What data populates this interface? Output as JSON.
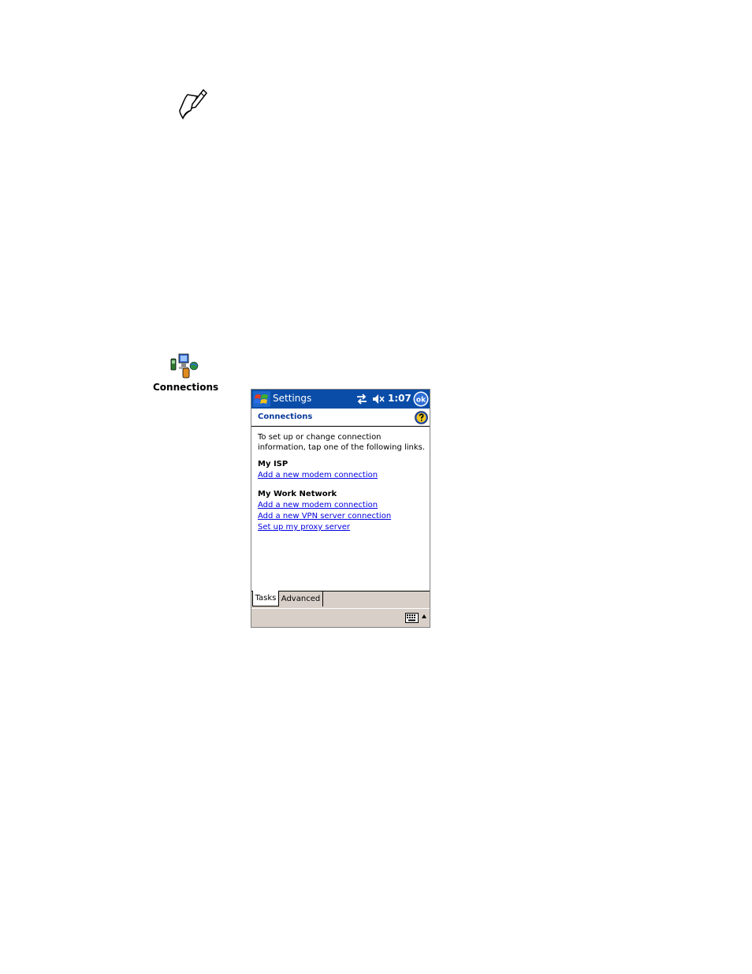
{
  "note_icon": "note-pencil-icon",
  "program_icon": {
    "icon": "connections-icon",
    "label": "Connections"
  },
  "device": {
    "titlebar": {
      "start_icon": "windows-flag-icon",
      "title": "Settings",
      "status_icons": [
        "connectivity-arrows-icon",
        "speaker-muted-icon"
      ],
      "time": "1:07",
      "ok_label": "ok"
    },
    "page": {
      "title": "Connections",
      "help_icon": "help-icon",
      "intro": "To set up or change connection information, tap one of the following links.",
      "sections": [
        {
          "heading": "My ISP",
          "links": [
            "Add a new modem connection"
          ]
        },
        {
          "heading": "My Work Network",
          "links": [
            "Add a new modem connection",
            "Add a new VPN server connection",
            "Set up my proxy server"
          ]
        }
      ]
    },
    "tabs": [
      "Tasks",
      "Advanced"
    ],
    "active_tab": "Tasks",
    "menubar": {
      "keyboard_icon": "keyboard-icon",
      "arrow_icon": "up-arrow-icon"
    },
    "colors": {
      "titlebar": "#0a4da8",
      "link": "#0000e0",
      "bar": "#d8d0c8"
    }
  }
}
